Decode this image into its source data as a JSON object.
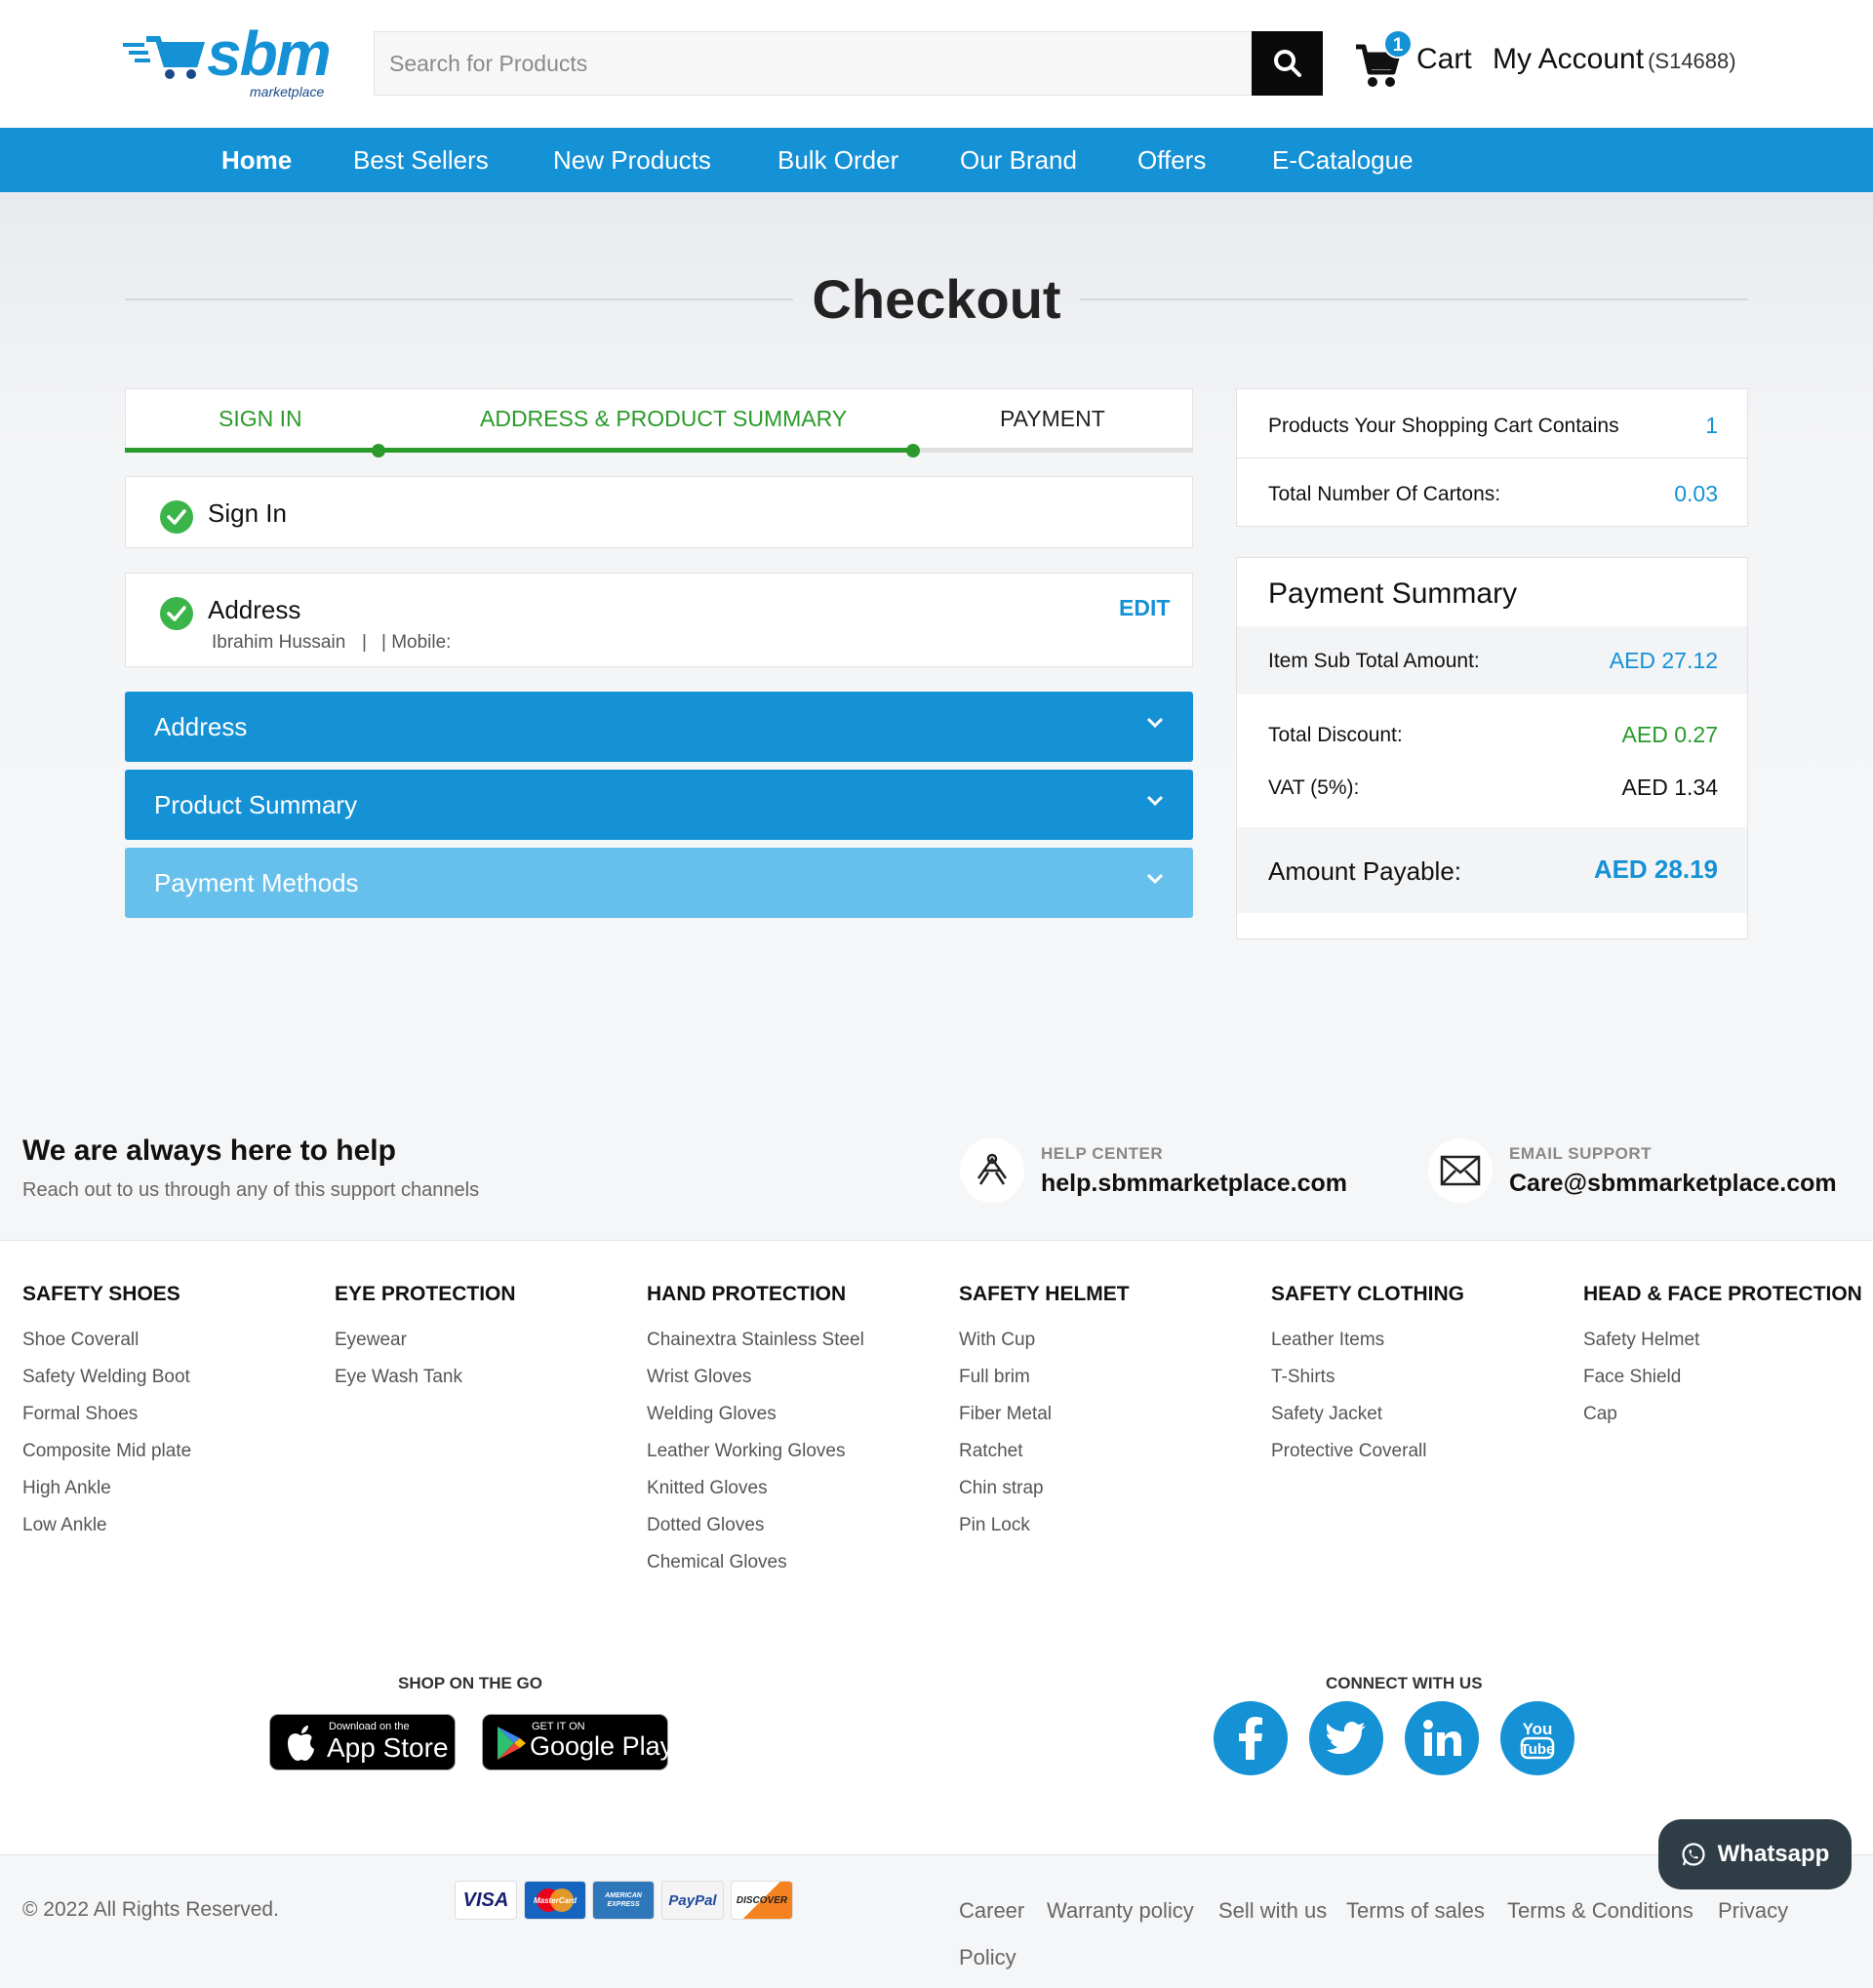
{
  "header": {
    "logo_text": "sbm",
    "logo_sub": "marketplace",
    "search_placeholder": "Search for Products",
    "cart_count": "1",
    "cart_label": "Cart",
    "account_label": "My Account",
    "account_id": "(S14688)"
  },
  "nav": {
    "items": [
      "Home",
      "Best Sellers",
      "New Products",
      "Bulk Order",
      "Our Brand",
      "Offers",
      "E-Catalogue"
    ]
  },
  "checkout": {
    "title": "Checkout",
    "steps": [
      "SIGN IN",
      "ADDRESS & PRODUCT SUMMARY",
      "PAYMENT"
    ],
    "signin_title": "Sign In",
    "address_title": "Address",
    "address_name": "Ibrahim Hussain",
    "address_sep": "|",
    "address_mobile": "| Mobile:",
    "edit_label": "EDIT",
    "accordion": [
      "Address",
      "Product Summary",
      "Payment Methods"
    ]
  },
  "cart_summary": {
    "products_label": "Products Your Shopping Cart Contains",
    "products_value": "1",
    "cartons_label": "Total Number Of Cartons:",
    "cartons_value": "0.03"
  },
  "payment_summary": {
    "title": "Payment Summary",
    "subtotal_label": "Item Sub Total Amount:",
    "subtotal_value": "AED 27.12",
    "discount_label": "Total Discount:",
    "discount_value": "AED 0.27",
    "vat_label": "VAT (5%):",
    "vat_value": "AED 1.34",
    "payable_label": "Amount Payable:",
    "payable_value": "AED 28.19"
  },
  "help": {
    "title": "We are always here to help",
    "subtitle": "Reach out to us through any of this support channels",
    "center_label": "HELP CENTER",
    "center_value": "help.sbmmarketplace.com",
    "email_label": "EMAIL SUPPORT",
    "email_value": "Care@sbmmarketplace.com"
  },
  "footer_columns": [
    {
      "title": "SAFETY SHOES",
      "links": [
        "Shoe Coverall",
        "Safety Welding Boot",
        "Formal Shoes",
        "Composite Mid plate",
        "High Ankle",
        "Low Ankle"
      ]
    },
    {
      "title": "EYE PROTECTION",
      "links": [
        "Eyewear",
        "Eye Wash Tank"
      ]
    },
    {
      "title": "HAND PROTECTION",
      "links": [
        "Chainextra Stainless Steel",
        "Wrist Gloves",
        "Welding Gloves",
        "Leather Working Gloves",
        "Knitted Gloves",
        "Dotted Gloves",
        "Chemical Gloves"
      ]
    },
    {
      "title": "SAFETY HELMET",
      "links": [
        "With Cup",
        "Full brim",
        "Fiber Metal",
        "Ratchet",
        "Chin strap",
        "Pin Lock"
      ]
    },
    {
      "title": "SAFETY CLOTHING",
      "links": [
        "Leather Items",
        "T-Shirts",
        "Safety Jacket",
        "Protective Coverall"
      ]
    },
    {
      "title": "HEAD & FACE PROTECTION",
      "links": [
        "Safety Helmet",
        "Face Shield",
        "Cap"
      ]
    }
  ],
  "apps": {
    "title": "SHOP ON THE GO",
    "appstore_small": "Download on the",
    "appstore_big": "App Store",
    "googleplay_small": "GET IT ON",
    "googleplay_big": "Google Play"
  },
  "social": {
    "title": "CONNECT WITH US",
    "icons": [
      "facebook-icon",
      "twitter-icon",
      "linkedin-icon",
      "youtube-icon"
    ]
  },
  "bottom": {
    "copyright": "© 2022 All Rights Reserved.",
    "payment_cards": [
      "VISA",
      "MasterCard",
      "AMERICAN EXPRESS",
      "PayPal",
      "DISCOVER"
    ],
    "links": [
      "Career",
      "Warranty policy",
      "Sell with us",
      "Terms of sales",
      "Terms & Conditions",
      "Privacy",
      "Policy"
    ]
  },
  "whatsapp": {
    "label": "Whatsapp"
  },
  "colors": {
    "brand_blue": "#1591d6",
    "success_green": "#2a9a2a",
    "light_blue": "#67c0ec"
  }
}
